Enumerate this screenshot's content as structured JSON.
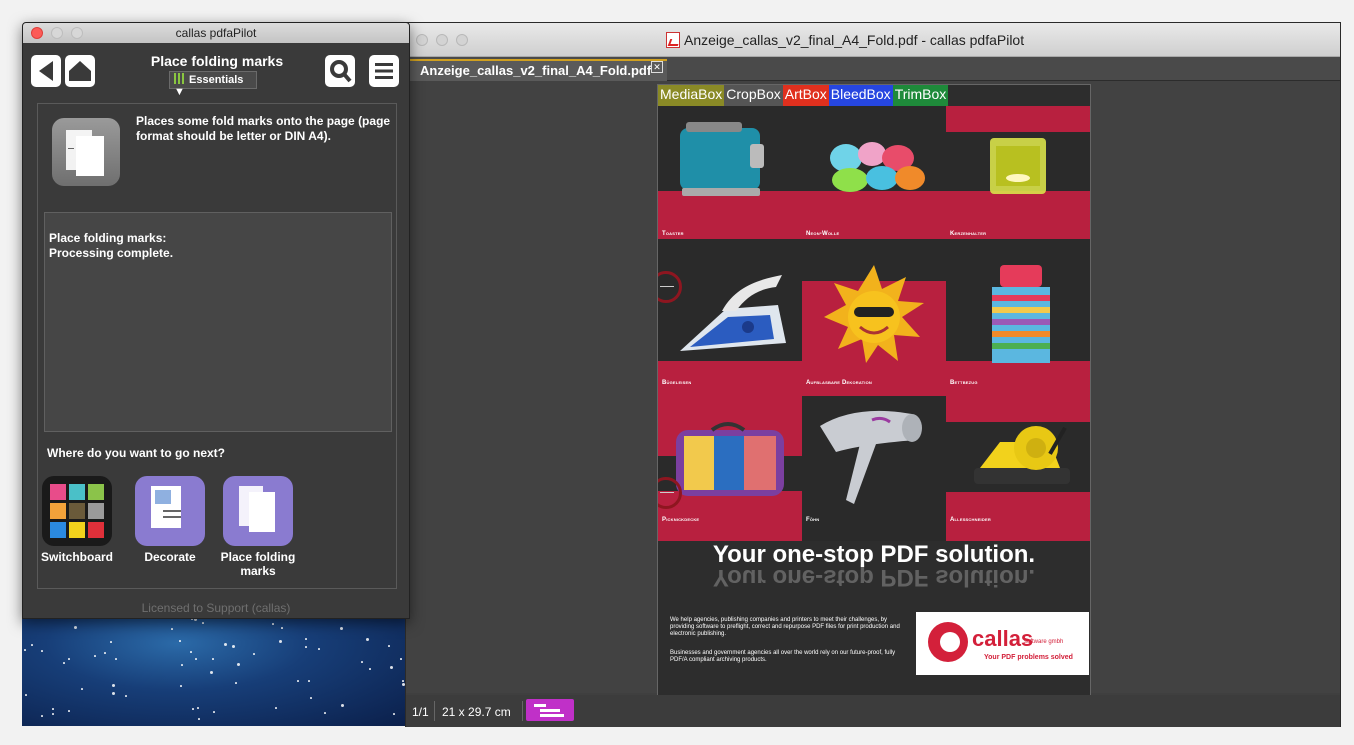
{
  "pilot": {
    "window_title": "callas pdfaPilot",
    "heading": "Place folding marks",
    "profile_selector": "Essentials",
    "description": "Places some fold marks onto the page (page format should be letter or DIN A4).",
    "log_lines": [
      "Place folding marks:",
      "Processing complete."
    ],
    "next_prompt": "Where do you want to go next?",
    "next_items": [
      {
        "label": "Switchboard",
        "icon": "switchboard-icon"
      },
      {
        "label": "Decorate",
        "icon": "decorate-icon"
      },
      {
        "label": "Place folding marks",
        "icon": "place-folding-marks-icon"
      }
    ],
    "license": "Licensed to Support (callas)"
  },
  "document": {
    "window_title": "Anzeige_callas_v2_final_A4_Fold.pdf - callas pdfaPilot",
    "tab_label": "Anzeige_callas_v2_final_A4_Fold.pdf",
    "page_counter": "1/1",
    "page_size": "21 x 29.7 cm",
    "box_legend": [
      {
        "label": "MediaBox",
        "color": "#8a8a26"
      },
      {
        "label": "CropBox",
        "color": "#555555"
      },
      {
        "label": "ArtBox",
        "color": "#e0301e"
      },
      {
        "label": "BleedBox",
        "color": "#2646e0"
      },
      {
        "label": "TrimBox",
        "color": "#1e8a3a"
      }
    ],
    "products": [
      "Toaster",
      "Neon-Wolle",
      "Kerzenhalter",
      "Bügeleisen",
      "Aufblasbare Dekoration",
      "Bettbezug",
      "Picknickdecke",
      "Föhn",
      "Allesschneider"
    ],
    "slogan": "Your one-stop PDF solution.",
    "blurb_1": "We help agencies, publishing companies and printers to meet their challenges, by providing software to preflight, correct and repurpose PDF files for print production and electronic publishing.",
    "blurb_2": "Businesses and government agencies all over the world rely on our future-proof, fully PDF/A compliant archiving products.",
    "logo_name": "callas",
    "logo_sub": "software gmbh",
    "logo_tagline": "Your PDF problems solved"
  },
  "colors": {
    "accent_red": "#b8203f",
    "purple_tile": "#8a7bd0",
    "struct_magenta": "#c030c8"
  }
}
